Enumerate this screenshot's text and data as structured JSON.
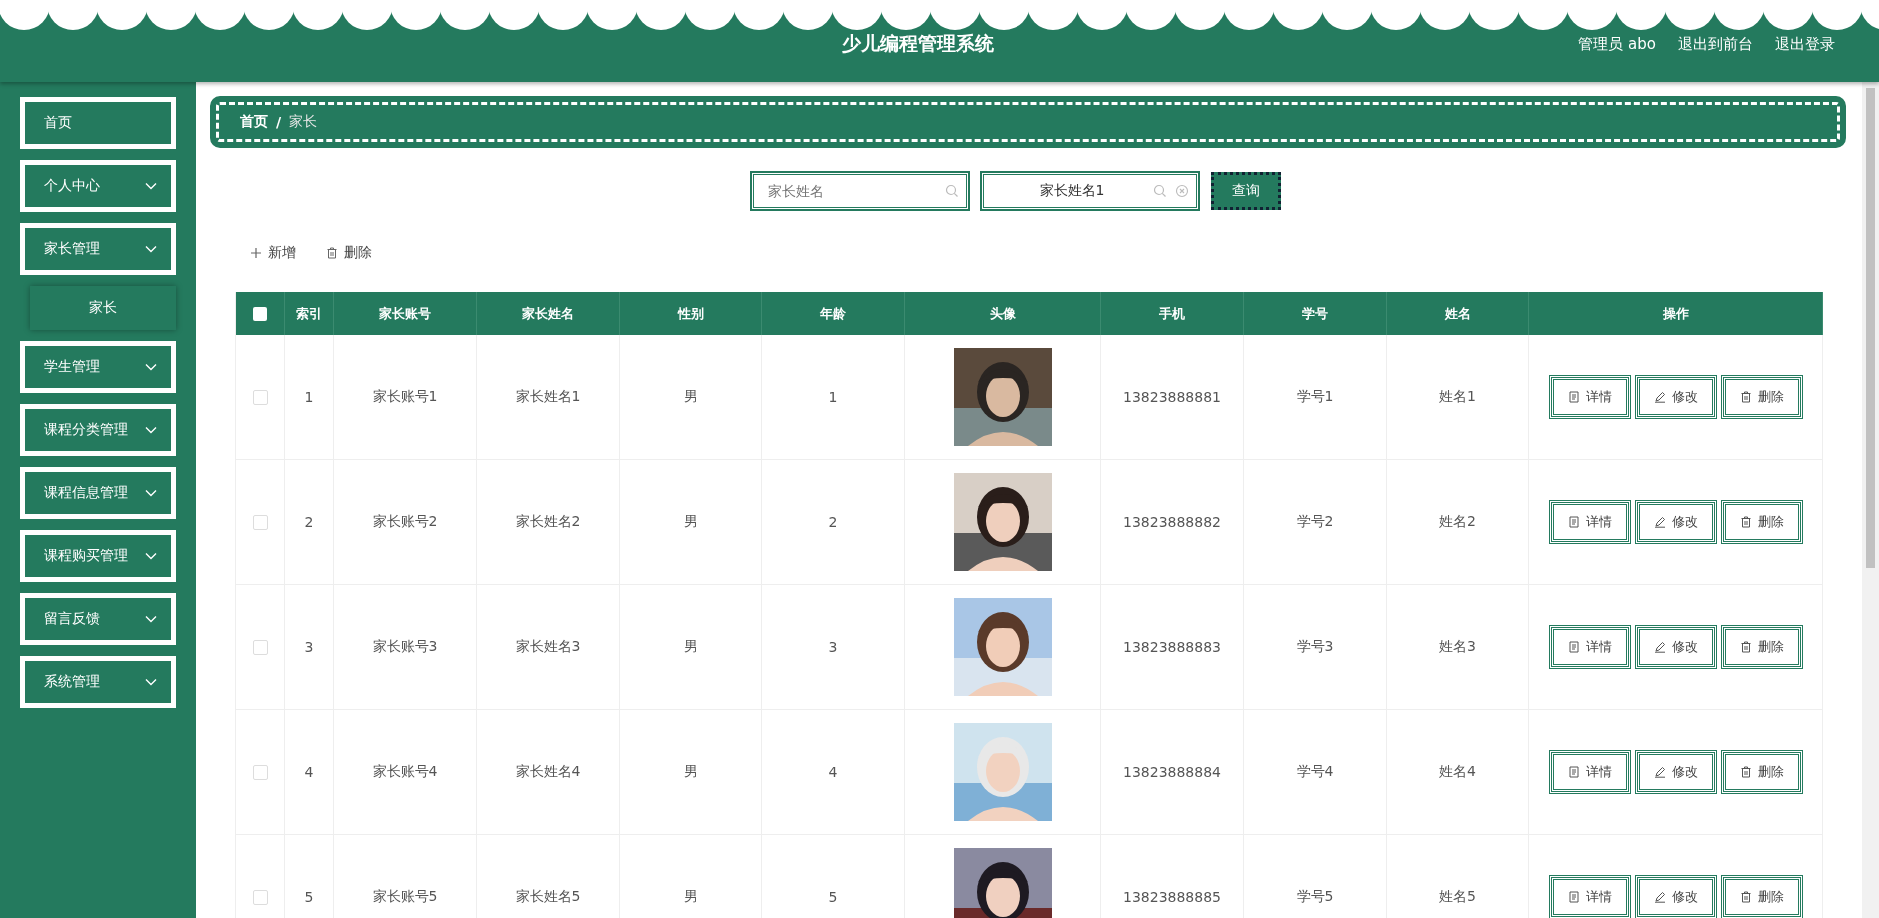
{
  "header": {
    "title": "少儿编程管理系统",
    "links": [
      "管理员 abo",
      "退出到前台",
      "退出登录"
    ]
  },
  "sidebar": {
    "items": [
      {
        "label": "首页",
        "kind": "link"
      },
      {
        "label": "个人中心",
        "kind": "menu"
      },
      {
        "label": "家长管理",
        "kind": "menu",
        "children": [
          {
            "label": "家长",
            "selected": true
          }
        ]
      },
      {
        "label": "学生管理",
        "kind": "menu"
      },
      {
        "label": "课程分类管理",
        "kind": "menu"
      },
      {
        "label": "课程信息管理",
        "kind": "menu"
      },
      {
        "label": "课程购买管理",
        "kind": "menu"
      },
      {
        "label": "留言反馈",
        "kind": "menu"
      },
      {
        "label": "系统管理",
        "kind": "menu"
      }
    ]
  },
  "breadcrumb": [
    "首页",
    "家长"
  ],
  "breadcrumb_separator": "/",
  "search": {
    "fields": [
      {
        "placeholder": "家长姓名",
        "clearable": false
      },
      {
        "value": "家长姓名1",
        "clearable": true
      }
    ],
    "button": "查询"
  },
  "toolbar": {
    "add": "新增",
    "delete": "删除"
  },
  "table": {
    "header_checked": false,
    "columns": [
      "索引",
      "家长账号",
      "家长姓名",
      "性别",
      "年龄",
      "头像",
      "手机",
      "学号",
      "姓名",
      "操作"
    ],
    "rows": [
      {
        "checked": false,
        "cells": [
          "1",
          "家长账号1",
          "家长姓名1",
          "男",
          "1",
          {
            "kind": "picture"
          },
          "13823888881",
          "学号1",
          "姓名1"
        ],
        "actions": [
          "详情",
          "修改",
          "删除"
        ]
      },
      {
        "checked": false,
        "cells": [
          "2",
          "家长账号2",
          "家长姓名2",
          "男",
          "2",
          {
            "kind": "picture"
          },
          "13823888882",
          "学号2",
          "姓名2"
        ],
        "actions": [
          "详情",
          "修改",
          "删除"
        ]
      },
      {
        "checked": false,
        "cells": [
          "3",
          "家长账号3",
          "家长姓名3",
          "男",
          "3",
          {
            "kind": "picture"
          },
          "13823888883",
          "学号3",
          "姓名3"
        ],
        "actions": [
          "详情",
          "修改",
          "删除"
        ]
      },
      {
        "checked": false,
        "cells": [
          "4",
          "家长账号4",
          "家长姓名4",
          "男",
          "4",
          {
            "kind": "picture"
          },
          "13823888884",
          "学号4",
          "姓名4"
        ],
        "actions": [
          "详情",
          "修改",
          "删除"
        ]
      },
      {
        "checked": false,
        "cells": [
          "5",
          "家长账号5",
          "家长姓名5",
          "男",
          "5",
          {
            "kind": "picture"
          },
          "13823888885",
          "学号5",
          "姓名5"
        ],
        "actions": [
          "详情",
          "修改",
          "删除"
        ]
      }
    ]
  }
}
